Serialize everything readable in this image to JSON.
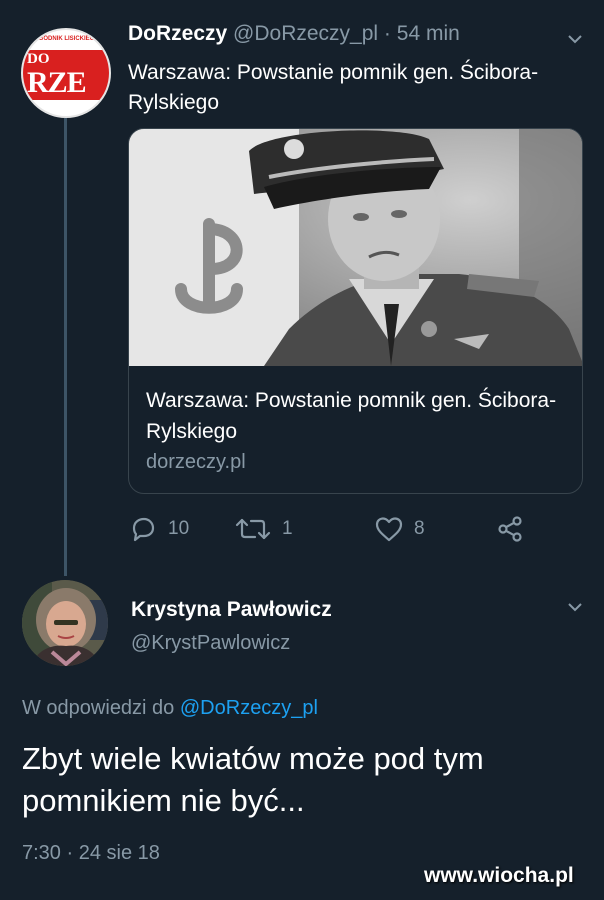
{
  "tweet1": {
    "display_name": "DoRzeczy",
    "handle": "@DoRzeczy_pl",
    "separator": "·",
    "time_ago": "54 min",
    "text": "Warszawa: Powstanie pomnik gen. Ścibora-Rylskiego",
    "avatar": {
      "small_text": "TYGODNIK LISICKIEGO",
      "line1": "DO",
      "line2": "RZE"
    },
    "card": {
      "title": "Warszawa: Powstanie pomnik gen. Ścibora-Rylskiego",
      "domain": "dorzeczy.pl"
    },
    "actions": {
      "replies": "10",
      "retweets": "1",
      "likes": "8",
      "icons": [
        "reply-icon",
        "retweet-icon",
        "like-icon",
        "share-icon"
      ]
    }
  },
  "tweet2": {
    "display_name": "Krystyna Pawłowicz",
    "handle": "@KrystPawlowicz",
    "reply_prefix": "W odpowiedzi do",
    "reply_to": "@DoRzeczy_pl",
    "text": "Zbyt wiele kwiatów może pod tym pomnikiem nie być...",
    "timestamp": "7:30 · 24 sie 18"
  },
  "watermark": "www.wiocha.pl",
  "colors": {
    "background": "#15202b",
    "secondary_text": "#8899a6",
    "link": "#1da1f2",
    "brand_red": "#d9201f"
  }
}
